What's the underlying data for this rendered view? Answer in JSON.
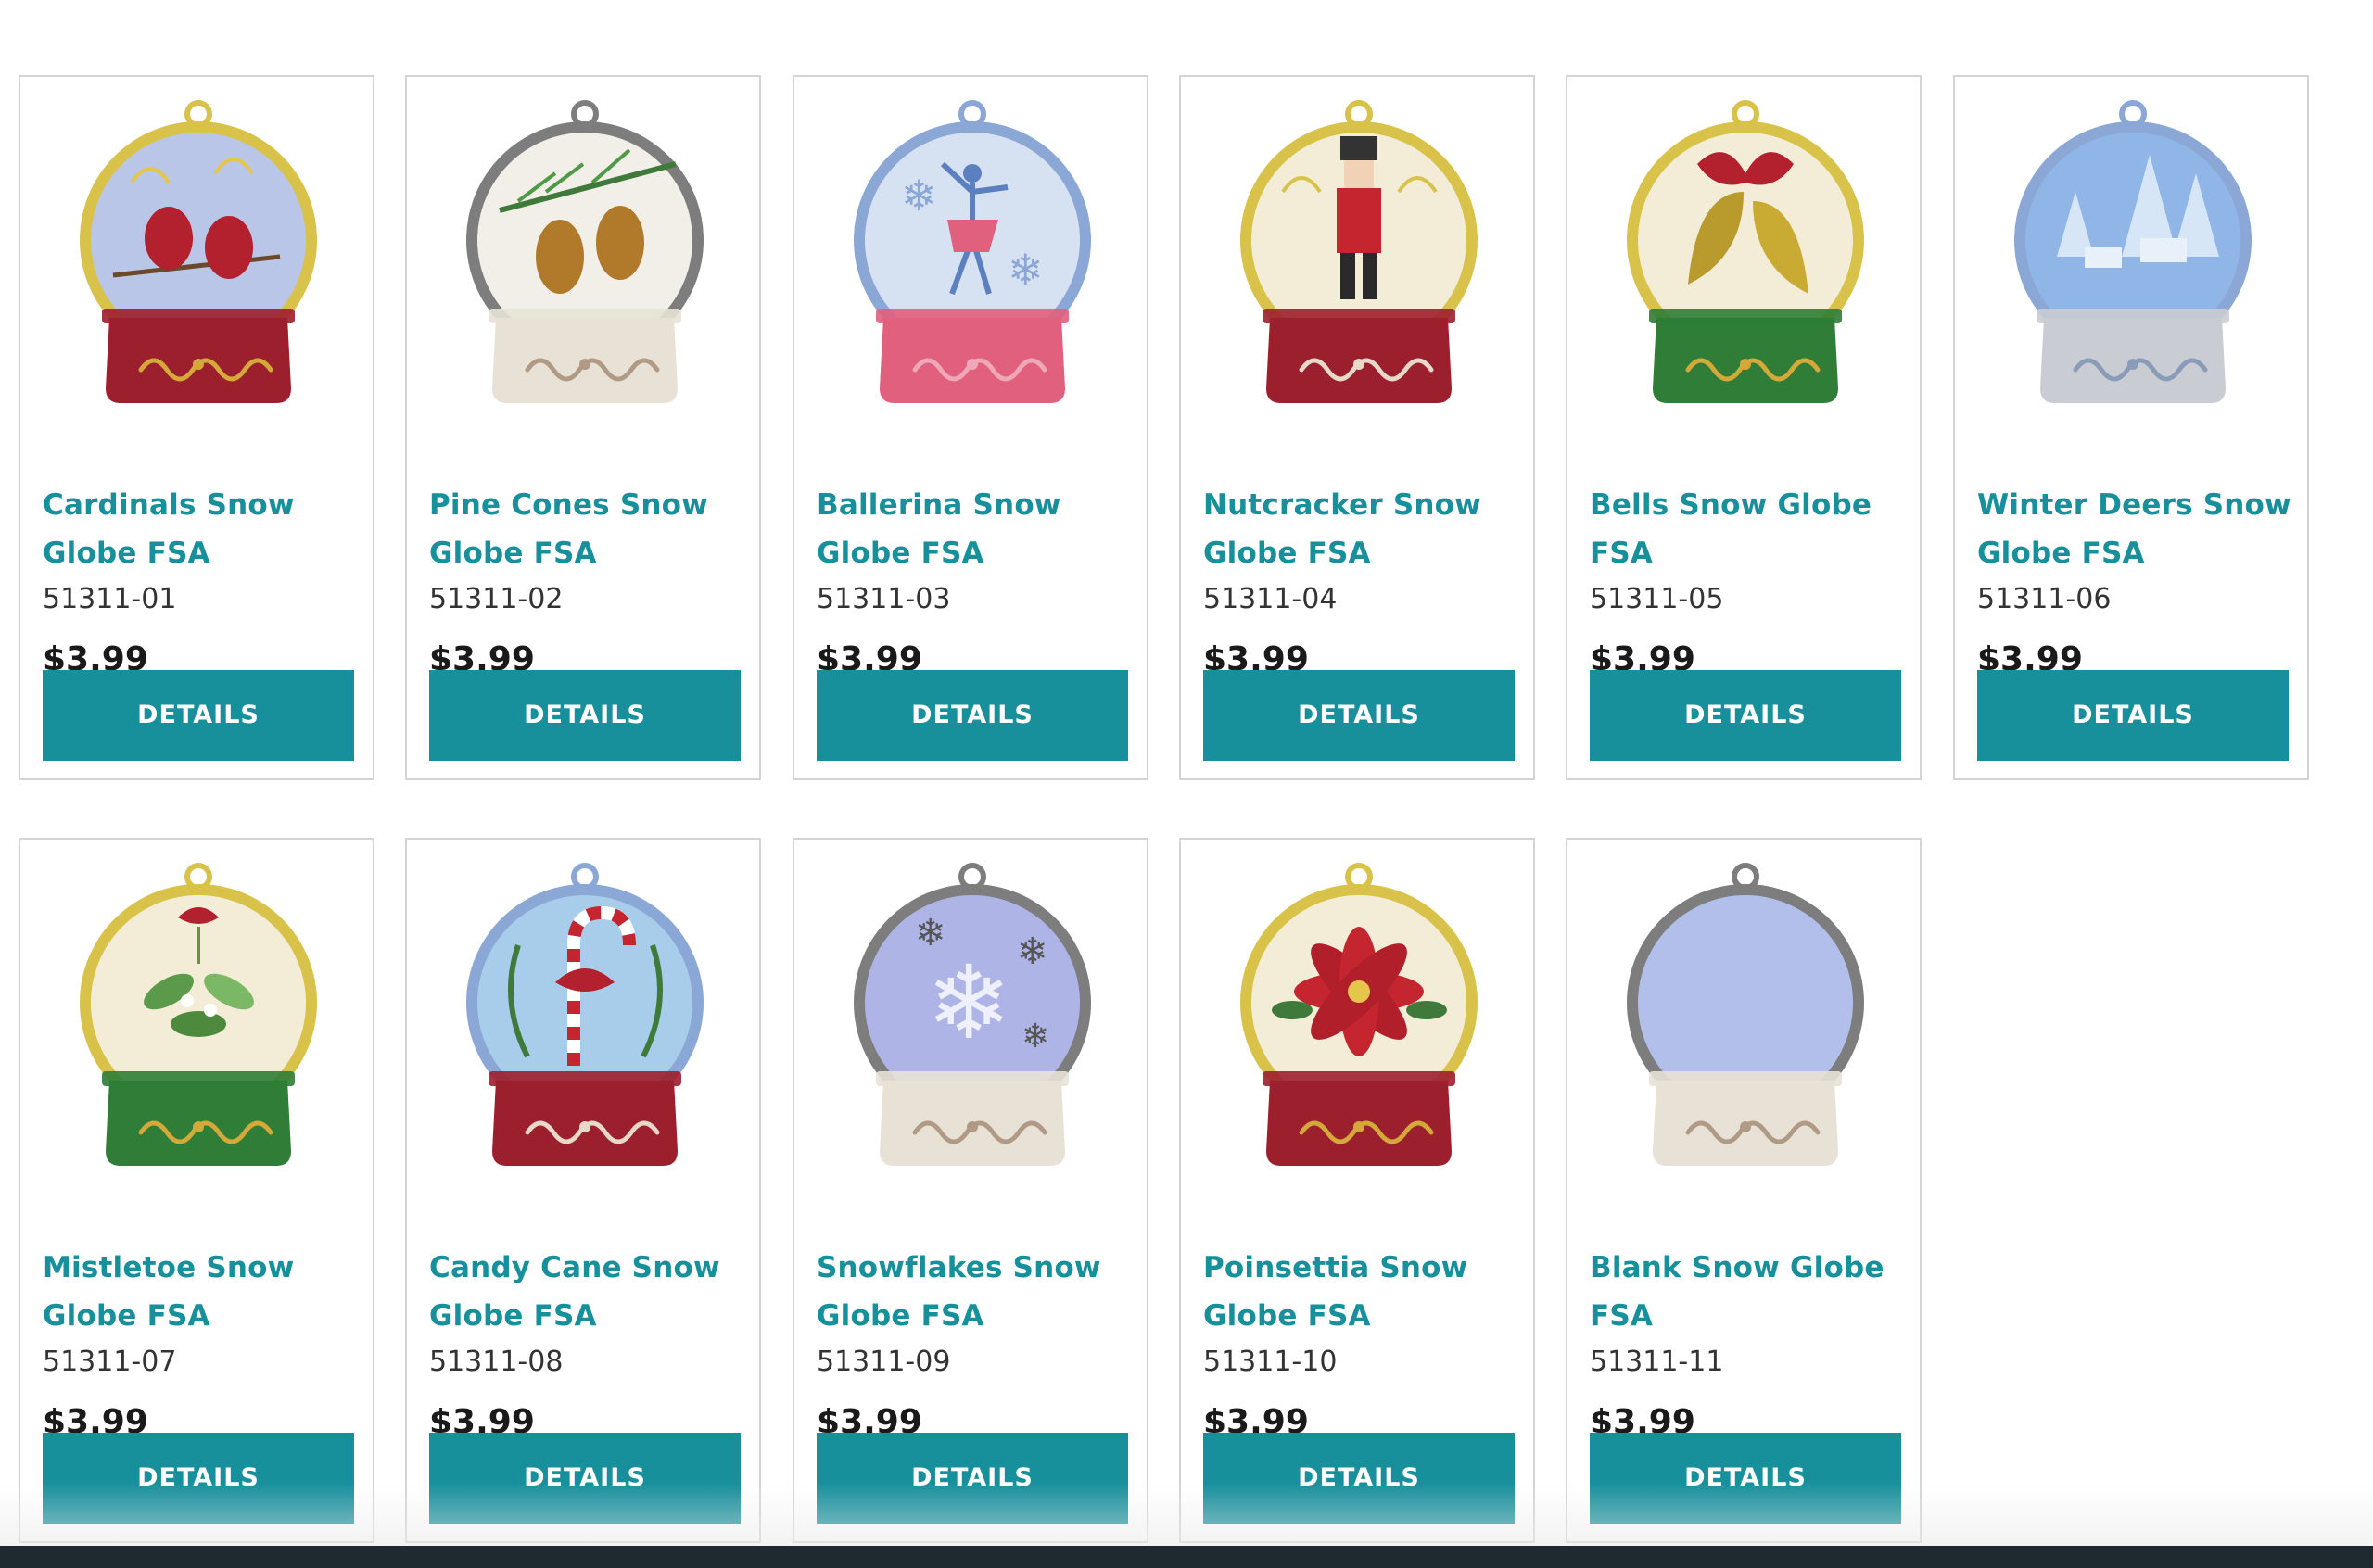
{
  "products": [
    {
      "title": "Cardinals Snow Globe FSA",
      "sku": "51311-01",
      "price": "$3.99",
      "button": "DETAILS",
      "ring": "#d9c24a",
      "globe": "#b9c6e8",
      "base": "#9c1f2e",
      "scroll": "#d4a93a",
      "motif": "cardinals"
    },
    {
      "title": "Pine Cones Snow Globe FSA",
      "sku": "51311-02",
      "price": "$3.99",
      "button": "DETAILS",
      "ring": "#7d7d7d",
      "globe": "#f1efe8",
      "base": "#e8e2d6",
      "scroll": "#b09a85",
      "motif": "pinecones"
    },
    {
      "title": "Ballerina Snow Globe FSA",
      "sku": "51311-03",
      "price": "$3.99",
      "button": "DETAILS",
      "ring": "#8aa7d6",
      "globe": "#d6e1f2",
      "base": "#e0607e",
      "scroll": "#f0a8b8",
      "motif": "ballerina"
    },
    {
      "title": "Nutcracker Snow Globe FSA",
      "sku": "51311-04",
      "price": "$3.99",
      "button": "DETAILS",
      "ring": "#d9c24a",
      "globe": "#f3edd8",
      "base": "#9c1f2e",
      "scroll": "#e8d8c8",
      "motif": "nutcracker"
    },
    {
      "title": "Bells Snow Globe FSA",
      "sku": "51311-05",
      "price": "$3.99",
      "button": "DETAILS",
      "ring": "#d9c24a",
      "globe": "#f3edd8",
      "base": "#2f7d36",
      "scroll": "#d4a93a",
      "motif": "bells"
    },
    {
      "title": "Winter Deers Snow Globe FSA",
      "sku": "51311-06",
      "price": "$3.99",
      "button": "DETAILS",
      "ring": "#8aa7d6",
      "globe": "#8fb6e6",
      "base": "#c9ccd2",
      "scroll": "#8a9bb8",
      "motif": "deers"
    },
    {
      "title": "Mistletoe Snow Globe FSA",
      "sku": "51311-07",
      "price": "$3.99",
      "button": "DETAILS",
      "ring": "#d9c24a",
      "globe": "#f3edd8",
      "base": "#2f7d36",
      "scroll": "#d4a93a",
      "motif": "mistletoe"
    },
    {
      "title": "Candy Cane Snow Globe FSA",
      "sku": "51311-08",
      "price": "$3.99",
      "button": "DETAILS",
      "ring": "#8aa7d6",
      "globe": "#a8cdeb",
      "base": "#9c1f2e",
      "scroll": "#e8d8c8",
      "motif": "candycane"
    },
    {
      "title": "Snowflakes Snow Globe FSA",
      "sku": "51311-09",
      "price": "$3.99",
      "button": "DETAILS",
      "ring": "#7d7d7d",
      "globe": "#aeb5e6",
      "base": "#e8e2d6",
      "scroll": "#b09a85",
      "motif": "snowflakes"
    },
    {
      "title": "Poinsettia Snow Globe FSA",
      "sku": "51311-10",
      "price": "$3.99",
      "button": "DETAILS",
      "ring": "#d9c24a",
      "globe": "#f3edd8",
      "base": "#9c1f2e",
      "scroll": "#d4a93a",
      "motif": "poinsettia"
    },
    {
      "title": "Blank Snow Globe FSA",
      "sku": "51311-11",
      "price": "$3.99",
      "button": "DETAILS",
      "ring": "#7d7d7d",
      "globe": "#b3bfeb",
      "base": "#e8e2d6",
      "scroll": "#b09a85",
      "motif": "blank"
    }
  ],
  "colors": {
    "accent": "#17909c",
    "price": "#1a1a1a",
    "sku": "#333333",
    "card_border": "#d4d4d4"
  }
}
